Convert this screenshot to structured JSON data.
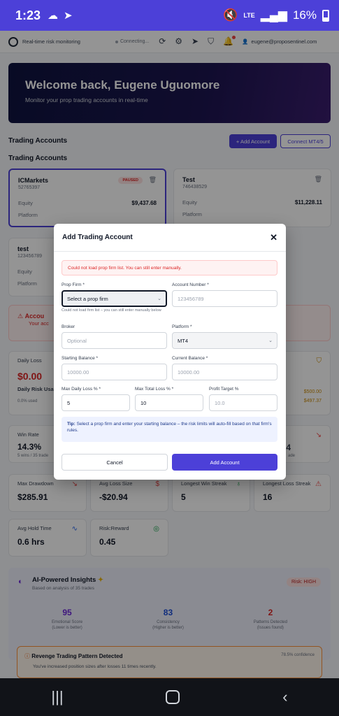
{
  "status_bar": {
    "time": "1:23",
    "network": "LTE",
    "battery": "16%"
  },
  "topnav": {
    "tagline": "Real-time risk monitoring",
    "connection": "Connecting...",
    "user_email": "eugene@proposentinel.com"
  },
  "hero": {
    "title": "Welcome back, Eugene Uguomore",
    "subtitle": "Monitor your prop trading accounts in real-time"
  },
  "accounts_section": {
    "header": "Trading Accounts",
    "subheader": "Trading Accounts",
    "add_label": "+ Add Account",
    "connect_label": "Connect MT4/5"
  },
  "accounts": [
    {
      "name": "ICMarkets",
      "number": "52765397",
      "badge": "PAUSED",
      "equity_label": "Equity",
      "equity": "$9,437.68",
      "platform_label": "Platform"
    },
    {
      "name": "Test",
      "number": "746438529",
      "equity_label": "Equity",
      "equity": "$11,228.11",
      "platform_label": "Platform"
    },
    {
      "name": "test",
      "number": "123456789",
      "equity_label": "Equity",
      "platform_label": "Platform"
    }
  ],
  "alert": {
    "title": "Accou",
    "text": "Your acc"
  },
  "daily": {
    "label": "Daily Loss",
    "value": "$0.00",
    "usage_label": "Daily Risk Usage",
    "usage_value": "0.0% used",
    "right1": "$500.00",
    "right2": "$497.37"
  },
  "winrate": {
    "label": "Win Rate",
    "value": "14.3%",
    "sub": "5 wins / 35 trade",
    "right_value": "4",
    "right_sub": "ade"
  },
  "metrics": [
    {
      "label": "Max Drawdown",
      "value": "$285.91"
    },
    {
      "label": "Avg Loss Size",
      "value": "-$20.94"
    },
    {
      "label": "Longest Win Streak",
      "value": "5"
    },
    {
      "label": "Longest Loss Streak",
      "value": "16"
    },
    {
      "label": "Avg Hold Time",
      "value": "0.6 hrs"
    },
    {
      "label": "Risk:Reward",
      "value": "0.45"
    }
  ],
  "ai": {
    "title": "AI-Powered Insights",
    "subtitle": "Based on analysis of 35 trades",
    "risk": "Risk: HIGH",
    "stats": [
      {
        "value": "95",
        "label": "Emotional Score",
        "sub": "(Lower is better)",
        "color": "#6d28d9"
      },
      {
        "value": "83",
        "label": "Consistency",
        "sub": "(Higher is better)",
        "color": "#1d4ed8"
      },
      {
        "value": "2",
        "label": "Patterns Detected",
        "sub": "(Issues found)",
        "color": "#dc2626"
      }
    ],
    "pattern_title": "Revenge Trading Pattern Detected",
    "pattern_conf": "78.5% confidence",
    "pattern_text": "You've increased position sizes after losses 11 times recently."
  },
  "modal": {
    "title": "Add Trading Account",
    "error": "Could not load prop firm list. You can still enter manually.",
    "prop_firm_label": "Prop Firm *",
    "prop_firm_value": "Select a prop firm",
    "prop_firm_hint": "Could not load firm list – you can still enter manually below",
    "account_number_label": "Account Number *",
    "account_number_placeholder": "123456789",
    "broker_label": "Broker",
    "broker_placeholder": "Optional",
    "platform_label": "Platform *",
    "platform_value": "MT4",
    "starting_balance_label": "Starting Balance *",
    "starting_balance_placeholder": "10000.00",
    "current_balance_label": "Current Balance *",
    "current_balance_placeholder": "10000.00",
    "max_daily_label": "Max Daily Loss % *",
    "max_daily_value": "5",
    "max_total_label": "Max Total Loss % *",
    "max_total_value": "10",
    "profit_target_label": "Profit Target %",
    "profit_target_placeholder": "10.0",
    "tip_label": "Tip:",
    "tip_text": "Select a prop firm and enter your starting balance – the risk limits will auto-fill based on that firm's rules.",
    "cancel_label": "Cancel",
    "submit_label": "Add Account"
  },
  "colors": {
    "accent": "#4c40d8",
    "danger": "#dc2626"
  }
}
